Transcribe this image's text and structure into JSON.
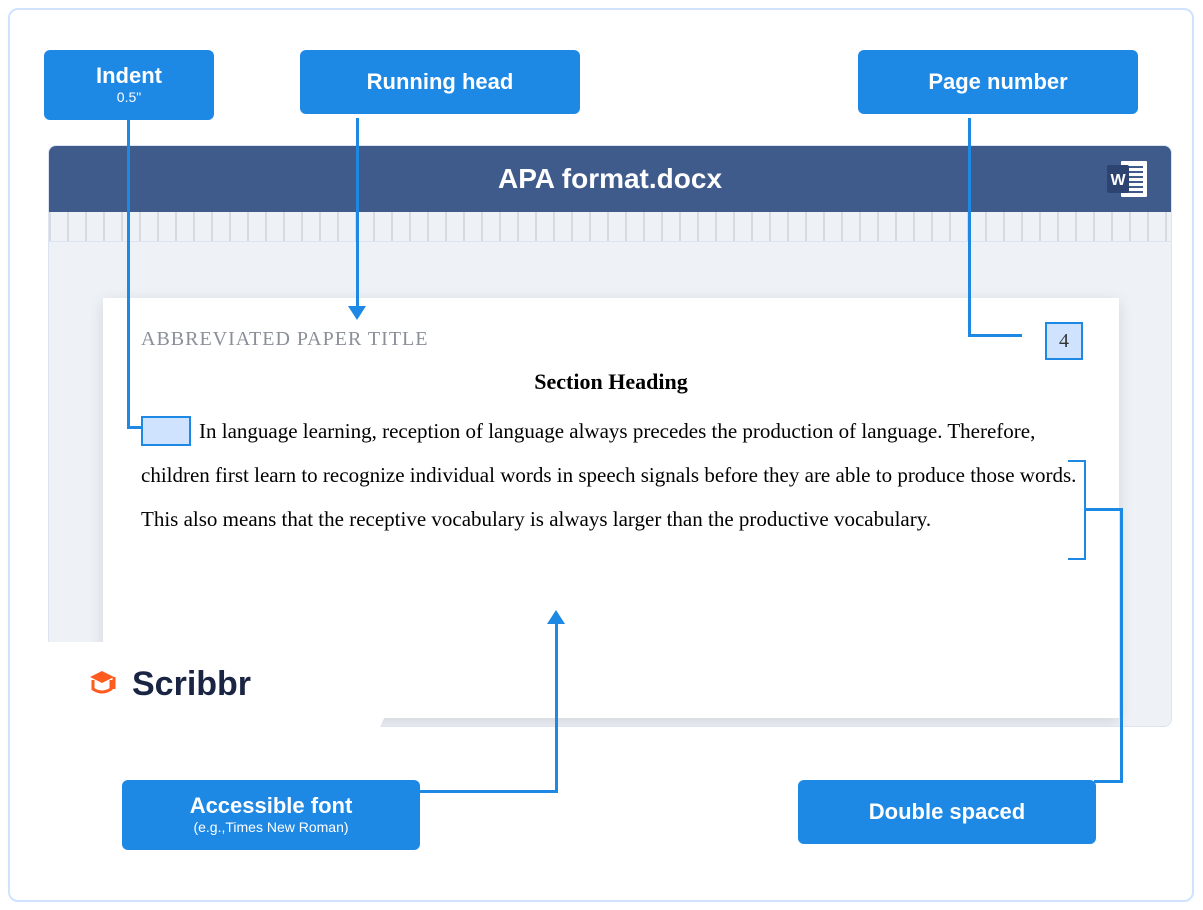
{
  "callouts": {
    "indent": {
      "label": "Indent",
      "sub": "0.5\""
    },
    "running_head": {
      "label": "Running head"
    },
    "page_number": {
      "label": "Page number"
    },
    "accessible_font": {
      "label": "Accessible font",
      "sub": "(e.g.,Times New Roman)"
    },
    "double_spaced": {
      "label": "Double spaced"
    }
  },
  "document": {
    "filename": "APA format.docx",
    "running_head_text": "ABBREVIATED PAPER TITLE",
    "page_number": "4",
    "section_heading": "Section Heading",
    "body_text": "In language learning, reception of language always precedes the production of language. Therefore, children first learn to recognize individual words in speech signals before they are able to produce those words. This also means that the receptive vocabulary is always larger than the productive vocabulary."
  },
  "brand": {
    "name": "Scribbr"
  }
}
